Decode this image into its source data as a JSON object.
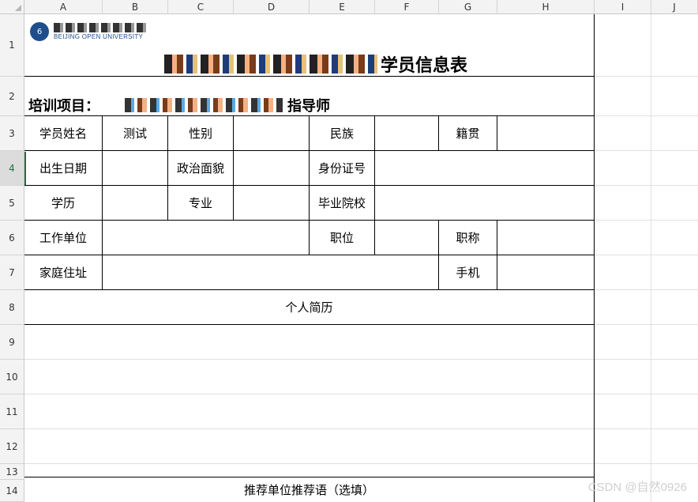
{
  "columns": [
    "A",
    "B",
    "C",
    "D",
    "E",
    "F",
    "G",
    "H",
    "I",
    "J"
  ],
  "rows": [
    "1",
    "2",
    "3",
    "4",
    "5",
    "6",
    "7",
    "8",
    "9",
    "10",
    "11",
    "12",
    "13",
    "14"
  ],
  "active_row": "4",
  "logo": {
    "subtitle": "BEIJING OPEN UNIVERSITY",
    "mark": "6"
  },
  "form": {
    "title_suffix": "学员信息表",
    "training_label": "培训项目：",
    "training_suffix": "指导师",
    "r3": {
      "name_label": "学员姓名",
      "name_value": "测试",
      "gender_label": "性别",
      "ethnic_label": "民族",
      "origin_label": "籍贯"
    },
    "r4": {
      "birth_label": "出生日期",
      "political_label": "政治面貌",
      "id_label": "身份证号"
    },
    "r5": {
      "edu_label": "学历",
      "major_label": "专业",
      "school_label": "毕业院校"
    },
    "r6": {
      "work_label": "工作单位",
      "position_label": "职位",
      "title_label": "职称"
    },
    "r7": {
      "address_label": "家庭住址",
      "phone_label": "手机"
    },
    "resume_label": "个人简历",
    "recommend_label": "推荐单位推荐语（选填）"
  },
  "watermark": "CSDN @自然0926"
}
